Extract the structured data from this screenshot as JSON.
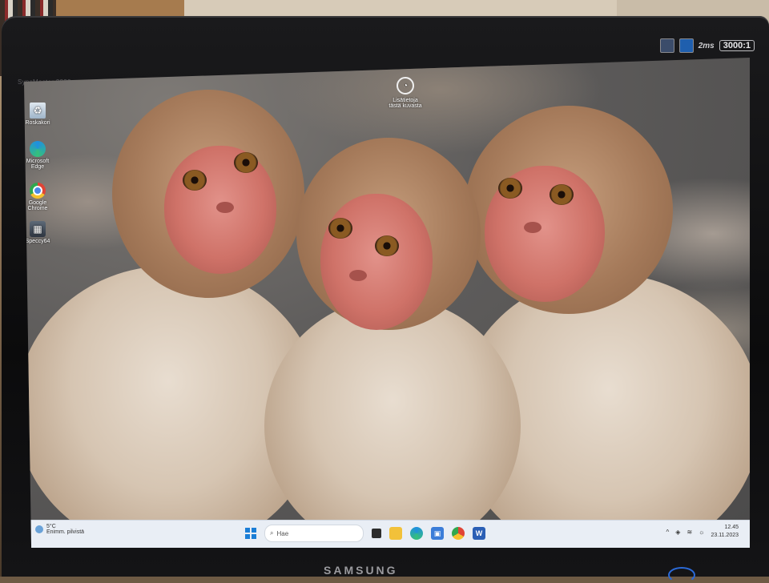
{
  "bezel": {
    "model": "SyncMaster 2233sw",
    "response_time": "2ms",
    "contrast": "3000:1",
    "brand": "SAMSUNG"
  },
  "desktop": {
    "icons": [
      {
        "label": "Roskakori",
        "icon": "recycle-bin-icon"
      },
      {
        "label": "Microsoft Edge",
        "icon": "edge-icon"
      },
      {
        "label": "Google Chrome",
        "icon": "chrome-icon"
      },
      {
        "label": "Speccy64",
        "icon": "speccy-icon"
      }
    ],
    "center_widget": {
      "line1": "Lisätietoja",
      "line2": "tästä kuvasta",
      "icon": "camera-icon"
    }
  },
  "taskbar": {
    "weather": {
      "line1": "5°C",
      "line2": "Enimm. pilvistä",
      "icon": "weather-icon"
    },
    "search_placeholder": "Hae",
    "apps": [
      {
        "name": "task-view",
        "icon": "task-view-icon"
      },
      {
        "name": "file-explorer",
        "icon": "folder-icon"
      },
      {
        "name": "edge",
        "icon": "edge-icon"
      },
      {
        "name": "store",
        "icon": "store-icon"
      },
      {
        "name": "chrome",
        "icon": "chrome-icon"
      },
      {
        "name": "word",
        "icon": "word-icon",
        "label": "W"
      }
    ],
    "tray": {
      "chevron": "^",
      "time": "12.45",
      "date": "23.11.2023"
    }
  },
  "colors": {
    "accent": "#1b7ed6",
    "taskbar_bg": "#e9eef5"
  }
}
